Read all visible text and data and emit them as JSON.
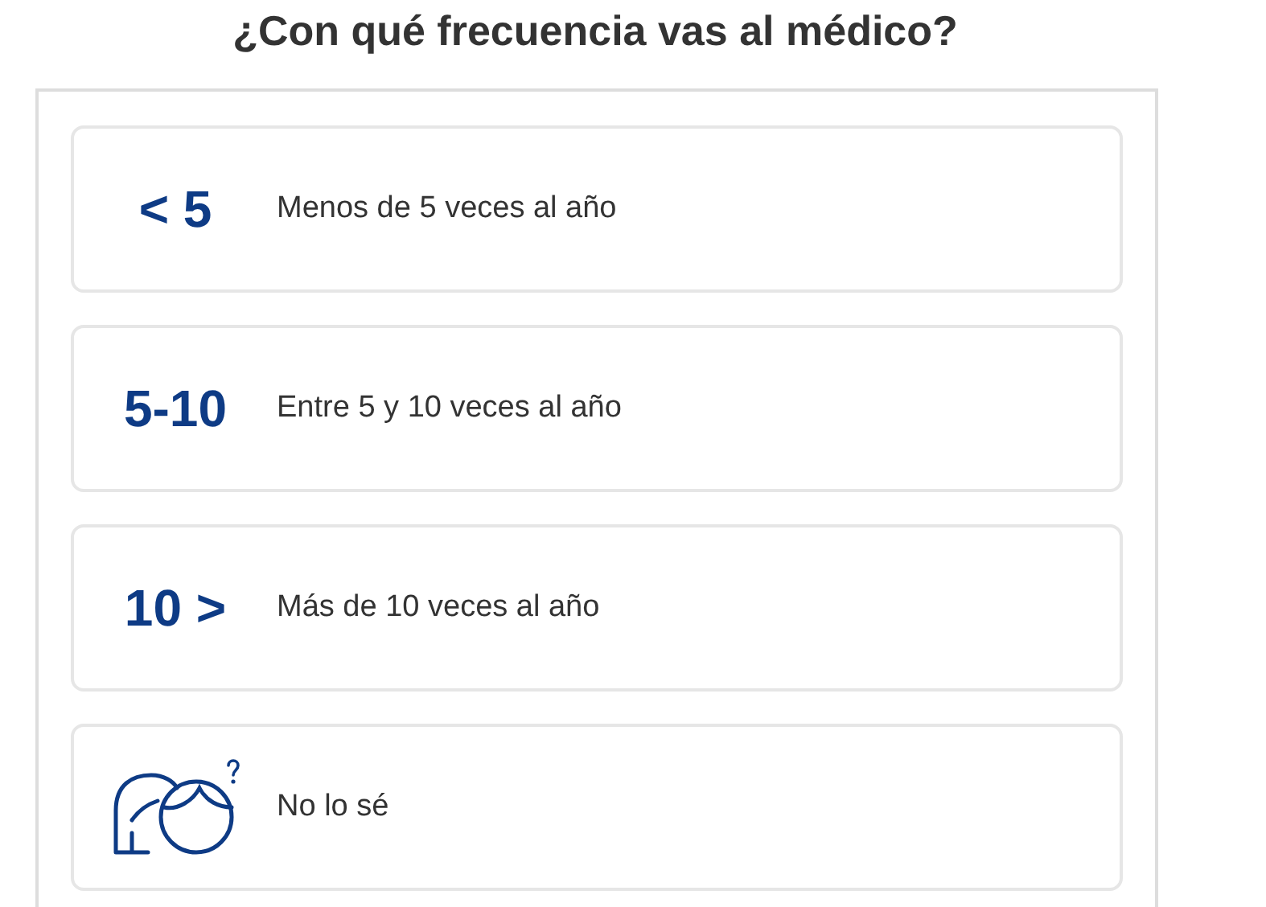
{
  "title": "¿Con qué frecuencia vas al médico?",
  "options": [
    {
      "kind": "number",
      "badge": "< 5",
      "label": "Menos de 5 veces al año"
    },
    {
      "kind": "number",
      "badge": "5-10",
      "label": "Entre 5 y 10 veces al año"
    },
    {
      "kind": "number",
      "badge": "10 >",
      "label": "Más de 10 veces al año"
    },
    {
      "kind": "icon",
      "label": "No lo sé"
    }
  ]
}
